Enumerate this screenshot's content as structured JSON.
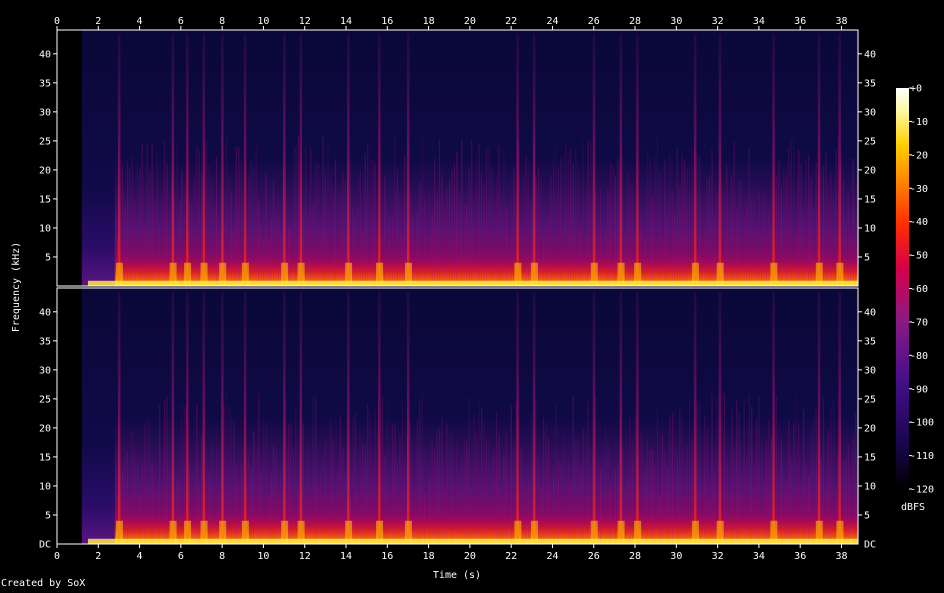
{
  "app": {
    "credit": "Created by SoX"
  },
  "chart_data": {
    "type": "heatmap",
    "subtype": "spectrogram",
    "channels": 2,
    "xlabel": "Time (s)",
    "ylabel": "Frequency (kHz)",
    "colorbar_label": "dBFS",
    "xlim": [
      0,
      38.8
    ],
    "ylim_khz": [
      0,
      44.1
    ],
    "x_ticks": [
      0,
      2,
      4,
      6,
      8,
      10,
      12,
      14,
      16,
      18,
      20,
      22,
      24,
      26,
      28,
      30,
      32,
      34,
      36,
      38
    ],
    "y_ticks_left": [
      40,
      35,
      30,
      25,
      20,
      15,
      10,
      5
    ],
    "y_ticks_right": [
      40,
      35,
      30,
      25,
      20,
      15,
      10,
      5
    ],
    "dc_label": "DC",
    "colorbar_range_db": [
      -120,
      0
    ],
    "colorbar_ticks": [
      "+0",
      "-10",
      "-20",
      "-30",
      "-40",
      "-50",
      "-60",
      "-70",
      "-80",
      "-90",
      "-100",
      "-110",
      "-120"
    ],
    "colormap": [
      "#ffffff",
      "#fff89c",
      "#ffd000",
      "#ff7e00",
      "#ff2d00",
      "#d5004a",
      "#8a1a85",
      "#48108a",
      "#1a0650",
      "#000000"
    ],
    "silence_until_s": 1.2,
    "loud_onsets_s": [
      3.0,
      5.6,
      6.3,
      7.1,
      8.0,
      9.1,
      11.0,
      11.8,
      14.1,
      15.6,
      17.0,
      22.3,
      23.1,
      26.0,
      27.3,
      28.1,
      30.9,
      32.1,
      34.7,
      36.9,
      37.9
    ]
  }
}
